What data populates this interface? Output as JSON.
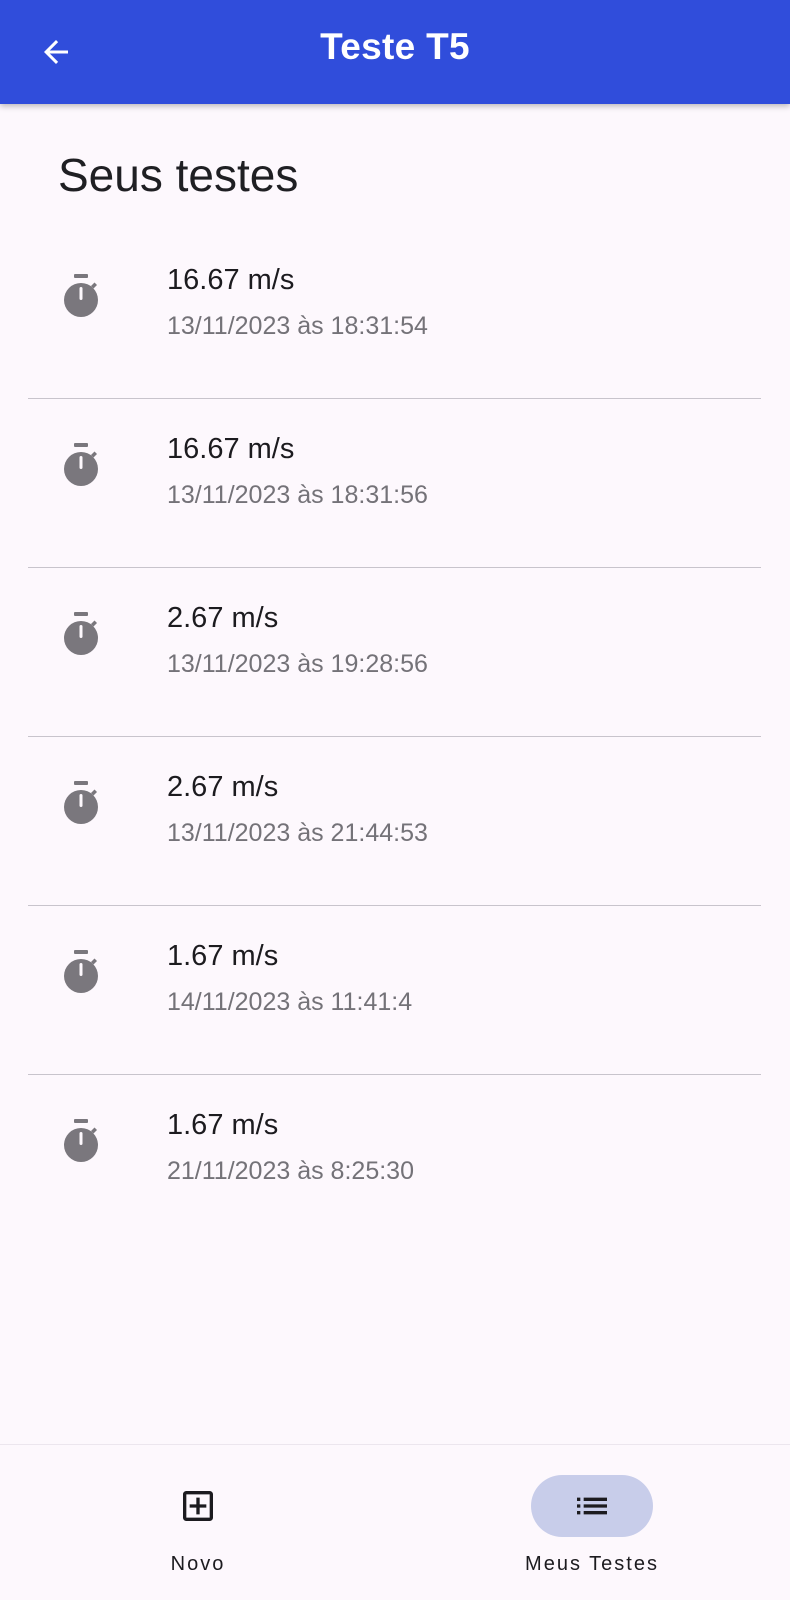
{
  "colors": {
    "appbar": "#304ddb",
    "background": "#fdf8fd",
    "icon": "#7a777d",
    "divider": "#c8c4cc",
    "active_indicator": "#c8cdea"
  },
  "appbar": {
    "back_icon": "arrow-back-icon",
    "title": "Teste T5"
  },
  "page": {
    "title": "Seus testes"
  },
  "tests": [
    {
      "icon": "stopwatch-icon",
      "speed": "16.67 m/s",
      "date": "13/11/2023 às 18:31:54"
    },
    {
      "icon": "stopwatch-icon",
      "speed": "16.67 m/s",
      "date": "13/11/2023 às 18:31:56"
    },
    {
      "icon": "stopwatch-icon",
      "speed": "2.67 m/s",
      "date": "13/11/2023 às 19:28:56"
    },
    {
      "icon": "stopwatch-icon",
      "speed": "2.67 m/s",
      "date": "13/11/2023 às 21:44:53"
    },
    {
      "icon": "stopwatch-icon",
      "speed": "1.67 m/s",
      "date": "14/11/2023 às 11:41:4"
    },
    {
      "icon": "stopwatch-icon",
      "speed": "1.67 m/s",
      "date": "21/11/2023 às 8:25:30"
    }
  ],
  "bottom_nav": {
    "items": [
      {
        "icon": "add-box-icon",
        "label": "Novo",
        "active": false
      },
      {
        "icon": "list-icon",
        "label": "Meus Testes",
        "active": true
      }
    ]
  }
}
